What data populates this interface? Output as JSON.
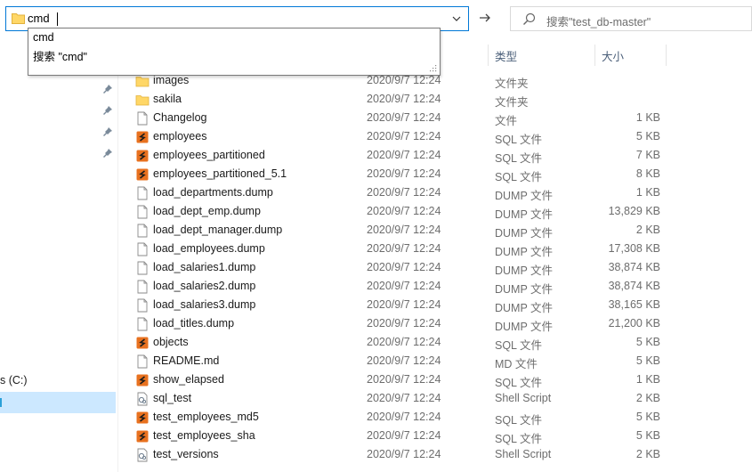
{
  "address_bar": {
    "value": "cmd"
  },
  "search": {
    "placeholder": "搜索\"test_db-master\""
  },
  "autocomplete": {
    "items": [
      "cmd",
      "搜索 \"cmd\""
    ]
  },
  "columns": {
    "type": "类型",
    "size": "大小"
  },
  "nav": {
    "drive_label": "s (C:)"
  },
  "files": [
    {
      "name": "images",
      "date": "2020/9/7 12:24",
      "type": "文件夹",
      "size": "",
      "icon": "folder-icon"
    },
    {
      "name": "sakila",
      "date": "2020/9/7 12:24",
      "type": "文件夹",
      "size": "",
      "icon": "folder-icon"
    },
    {
      "name": "Changelog",
      "date": "2020/9/7 12:24",
      "type": "文件",
      "size": "1 KB",
      "icon": "file-icon"
    },
    {
      "name": "employees",
      "date": "2020/9/7 12:24",
      "type": "SQL 文件",
      "size": "5 KB",
      "icon": "sql-file-icon"
    },
    {
      "name": "employees_partitioned",
      "date": "2020/9/7 12:24",
      "type": "SQL 文件",
      "size": "7 KB",
      "icon": "sql-file-icon"
    },
    {
      "name": "employees_partitioned_5.1",
      "date": "2020/9/7 12:24",
      "type": "SQL 文件",
      "size": "8 KB",
      "icon": "sql-file-icon"
    },
    {
      "name": "load_departments.dump",
      "date": "2020/9/7 12:24",
      "type": "DUMP 文件",
      "size": "1 KB",
      "icon": "file-icon"
    },
    {
      "name": "load_dept_emp.dump",
      "date": "2020/9/7 12:24",
      "type": "DUMP 文件",
      "size": "13,829 KB",
      "icon": "file-icon"
    },
    {
      "name": "load_dept_manager.dump",
      "date": "2020/9/7 12:24",
      "type": "DUMP 文件",
      "size": "2 KB",
      "icon": "file-icon"
    },
    {
      "name": "load_employees.dump",
      "date": "2020/9/7 12:24",
      "type": "DUMP 文件",
      "size": "17,308 KB",
      "icon": "file-icon"
    },
    {
      "name": "load_salaries1.dump",
      "date": "2020/9/7 12:24",
      "type": "DUMP 文件",
      "size": "38,874 KB",
      "icon": "file-icon"
    },
    {
      "name": "load_salaries2.dump",
      "date": "2020/9/7 12:24",
      "type": "DUMP 文件",
      "size": "38,874 KB",
      "icon": "file-icon"
    },
    {
      "name": "load_salaries3.dump",
      "date": "2020/9/7 12:24",
      "type": "DUMP 文件",
      "size": "38,165 KB",
      "icon": "file-icon"
    },
    {
      "name": "load_titles.dump",
      "date": "2020/9/7 12:24",
      "type": "DUMP 文件",
      "size": "21,200 KB",
      "icon": "file-icon"
    },
    {
      "name": "objects",
      "date": "2020/9/7 12:24",
      "type": "SQL 文件",
      "size": "5 KB",
      "icon": "sql-file-icon"
    },
    {
      "name": "README.md",
      "date": "2020/9/7 12:24",
      "type": "MD 文件",
      "size": "5 KB",
      "icon": "file-icon"
    },
    {
      "name": "show_elapsed",
      "date": "2020/9/7 12:24",
      "type": "SQL 文件",
      "size": "1 KB",
      "icon": "sql-file-icon"
    },
    {
      "name": "sql_test",
      "date": "2020/9/7 12:24",
      "type": "Shell Script",
      "size": "2 KB",
      "icon": "script-file-icon"
    },
    {
      "name": "test_employees_md5",
      "date": "2020/9/7 12:24",
      "type": "SQL 文件",
      "size": "5 KB",
      "icon": "sql-file-icon"
    },
    {
      "name": "test_employees_sha",
      "date": "2020/9/7 12:24",
      "type": "SQL 文件",
      "size": "5 KB",
      "icon": "sql-file-icon"
    },
    {
      "name": "test_versions",
      "date": "2020/9/7 12:24",
      "type": "Shell Script",
      "size": "2 KB",
      "icon": "script-file-icon"
    }
  ],
  "colors": {
    "accent": "#0078d7",
    "selection": "#cce8ff",
    "folder": "#ffd767",
    "sql": "#e8711f"
  }
}
